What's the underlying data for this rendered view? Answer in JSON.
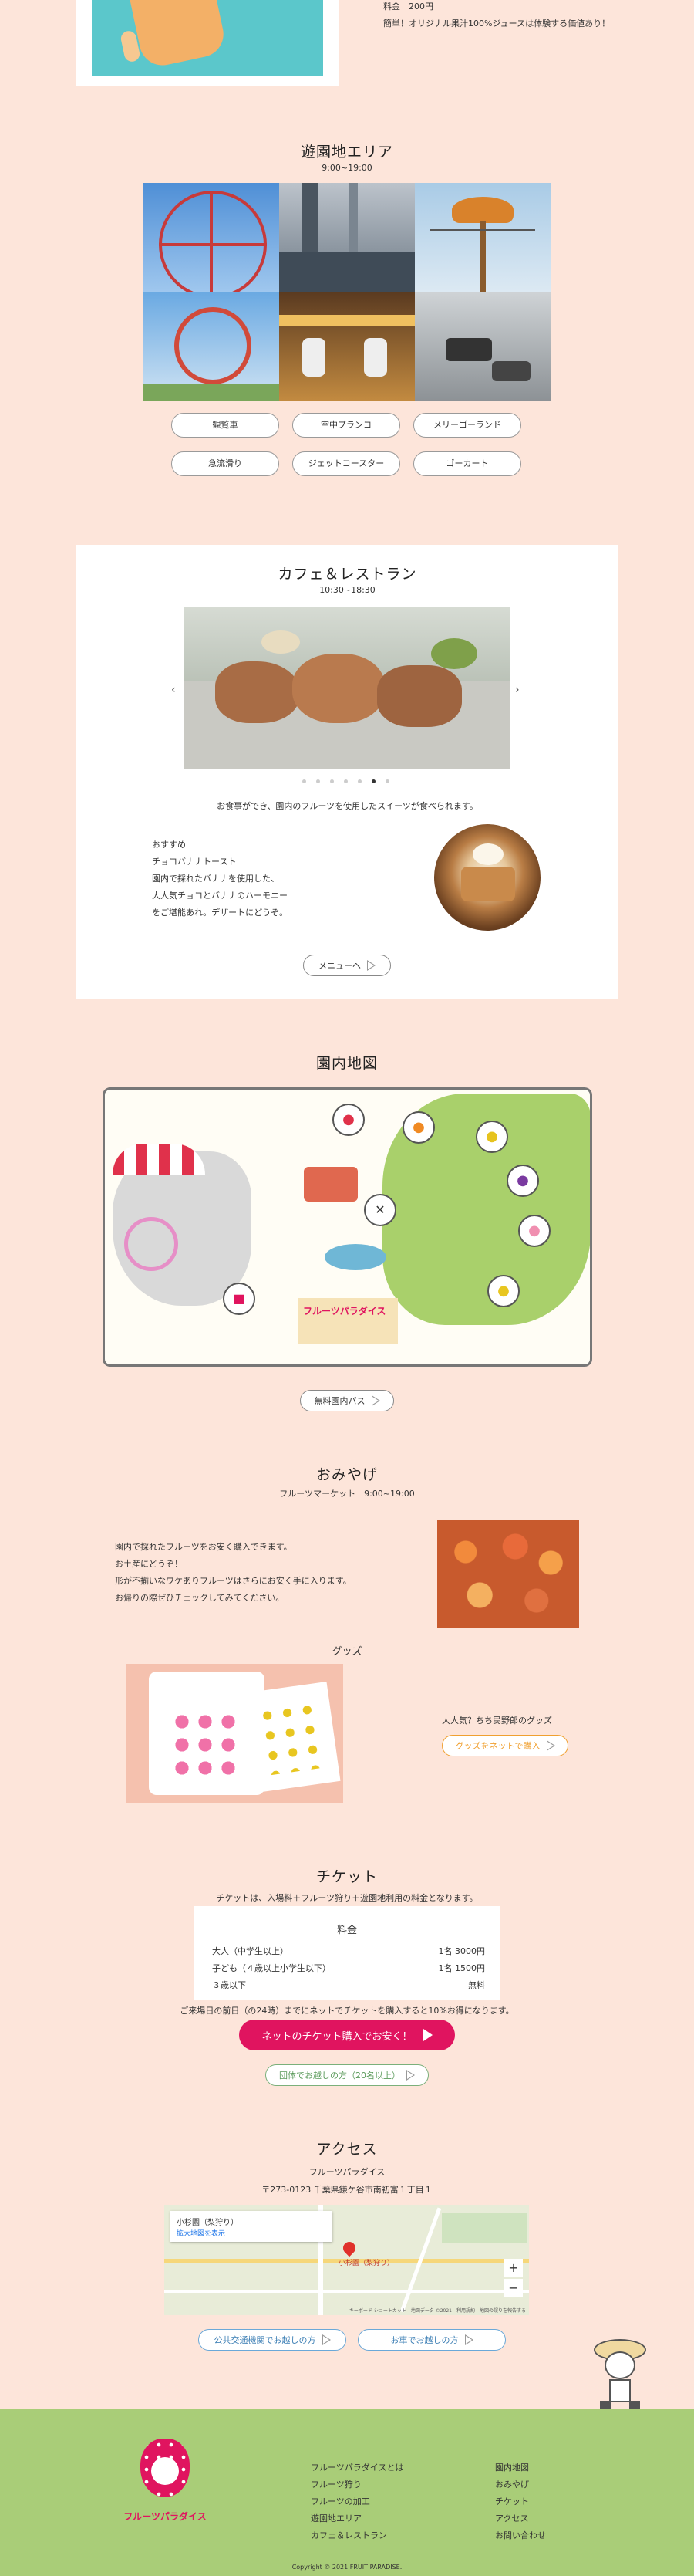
{
  "top": {
    "price_label": "料金　200円",
    "price_desc": "簡単！オリジナル果汁100%ジュースは体験する価値あり！"
  },
  "amusement": {
    "title": "遊園地エリア",
    "hours": "9:00~19:00",
    "rides": [
      "観覧車",
      "空中ブランコ",
      "メリーゴーランド",
      "急流滑り",
      "ジェットコースター",
      "ゴーカート"
    ]
  },
  "cafe": {
    "title": "カフェ＆レストラン",
    "hours": "10:30~18:30",
    "caption": "お食事ができ、園内のフルーツを使用したスイーツが食べられます。",
    "recommend_lines": [
      "おすすめ",
      "チョコバナナトースト",
      "園内で採れたバナナを使用した、",
      "大人気チョコとバナナのハーモニー",
      "をご堪能あれ。デザートにどうぞ。"
    ],
    "menu_button": "メニューへ",
    "slide_count": 7,
    "active_slide": 5
  },
  "map": {
    "title": "園内地図",
    "logo_text": "フルーツパラダイス",
    "pass_button": "無料園内パス"
  },
  "souvenir": {
    "title": "おみやげ",
    "sub": "フルーツマーケット　9:00~19:00",
    "lines": [
      "園内で採れたフルーツをお安く購入できます。",
      "お土産にどうぞ！",
      "形が不揃いなワケありフルーツはさらにお安く手に入ります。",
      "お帰りの際ぜひチェックしてみてください。"
    ],
    "goods_title": "グッズ",
    "goods_note": "大人気？ちち民野郎のグッズ",
    "goods_button": "グッズをネットで購入"
  },
  "ticket": {
    "title": "チケット",
    "desc": "チケットは、入場料＋フルーツ狩り＋遊園地利用の料金となります。",
    "table_title": "料金",
    "rows": [
      {
        "label": "大人（中学生以上）",
        "price": "1名 3000円"
      },
      {
        "label": "子ども（４歳以上小学生以下）",
        "price": "1名 1500円"
      },
      {
        "label": "３歳以下",
        "price": "無料"
      }
    ],
    "notice": "ご来場日の前日（の24時）までにネットでチケットを購入すると10%お得になります。",
    "buy_button": "ネットのチケット購入でお安く！",
    "group_button": "団体でお越しの方（20名以上）"
  },
  "access": {
    "title": "アクセス",
    "name": "フルーツパラダイス",
    "address": "〒273-0123 千葉県鎌ケ谷市南初富１丁目１",
    "map_place": "小杉園（梨狩り）",
    "map_link": "拡大地図を表示",
    "map_pin_label": "小杉園（梨狩り）",
    "map_credit": "キーボード ショートカット　地図データ ©2021　利用規約　地図の誤りを報告する",
    "public_button": "公共交通機関でお越しの方",
    "car_button": "お車でお越しの方"
  },
  "footer": {
    "logo_text": "フルーツパラダイス",
    "col1": [
      "フルーツパラダイスとは",
      "フルーツ狩り",
      "フルーツの加工",
      "遊園地エリア",
      "カフェ＆レストラン"
    ],
    "col2": [
      "園内地図",
      "おみやげ",
      "チケット",
      "アクセス",
      "お問い合わせ"
    ],
    "copyright": "Copyright © 2021 FRUIT PARADISE."
  },
  "colors": {
    "background": "#fde5da",
    "accent": "#e0145f",
    "footer": "#a9cd78",
    "goods_orange": "#f0a030"
  }
}
